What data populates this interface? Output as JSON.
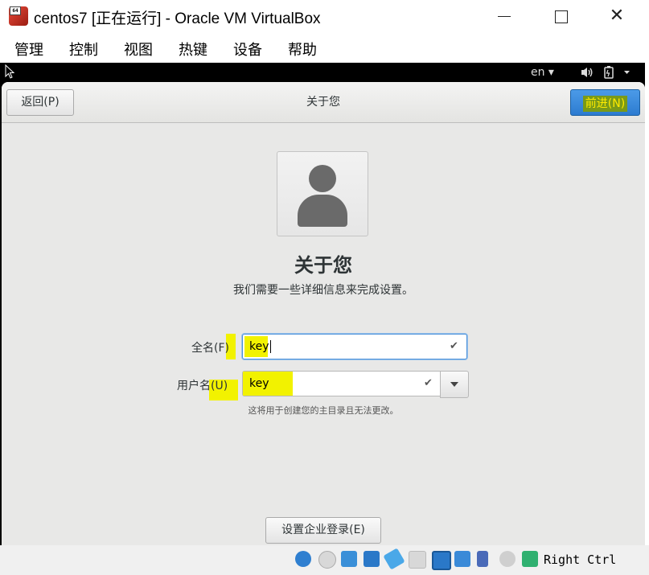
{
  "window": {
    "title": "centos7 [正在运行] - Oracle VM VirtualBox",
    "icon_badge": "64"
  },
  "menu": {
    "items": [
      "管理",
      "控制",
      "视图",
      "热键",
      "设备",
      "帮助"
    ]
  },
  "guest_topbar": {
    "language": "en ▾"
  },
  "header": {
    "back_label": "返回(P)",
    "title": "关于您",
    "next_label": "前进(N)"
  },
  "page": {
    "heading": "关于您",
    "subtitle": "我们需要一些详细信息来完成设置。"
  },
  "form": {
    "fullname_label": "全名(F)",
    "fullname_value": "key",
    "username_label": "用户名(U)",
    "username_value": "key",
    "hint": "这将用于创建您的主目录且无法更改。"
  },
  "enterprise_button": "设置企业登录(E)",
  "statusbar": {
    "host_key": "Right Ctrl"
  },
  "colors": {
    "highlight": "#f2f200",
    "accent": "#3584e4",
    "background": "#e8e8e7"
  }
}
